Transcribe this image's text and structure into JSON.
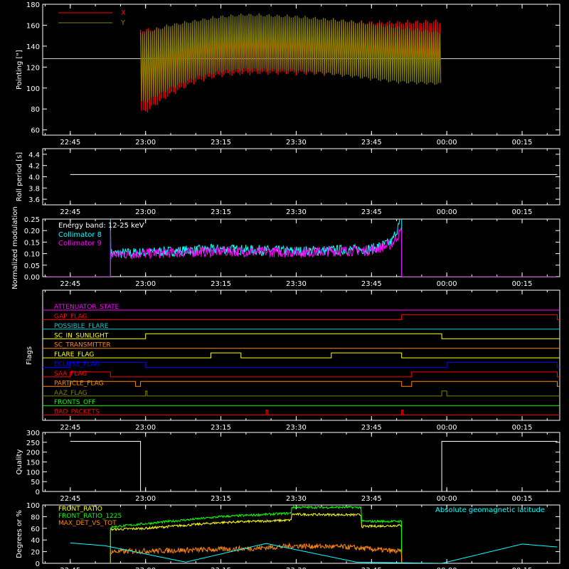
{
  "chart_data": {
    "type": "line",
    "time_ticks": [
      "22:45",
      "23:00",
      "23:15",
      "23:30",
      "23:45",
      "00:00",
      "00:15"
    ],
    "panels": [
      {
        "id": "pointing",
        "ylabel": "Pointing [\"]",
        "ylim": [
          55,
          180
        ],
        "yticks": [
          60,
          80,
          100,
          120,
          140,
          160,
          180
        ],
        "reference_line": 128,
        "legend": [
          {
            "name": "X",
            "color": "#ff0000"
          },
          {
            "name": "Y",
            "color": "#808000"
          }
        ],
        "series": [
          {
            "name": "X",
            "color": "#ff0000",
            "start": "22:59",
            "end": "23:59",
            "x_time": [
              "23:00",
              "23:05",
              "23:10",
              "23:15",
              "23:20",
              "23:30",
              "23:40",
              "23:50",
              "23:59"
            ],
            "upper": [
              158,
              160,
              162,
              163,
              164,
              164,
              165,
              165,
              166
            ],
            "lower": [
              75,
              92,
              104,
              110,
              112,
              112,
              111,
              111,
              110
            ]
          },
          {
            "name": "Y",
            "color": "#808000",
            "start": "22:59",
            "end": "23:59",
            "x_time": [
              "23:00",
              "23:05",
              "23:10",
              "23:15",
              "23:20",
              "23:30",
              "23:40",
              "23:50",
              "23:59"
            ],
            "upper": [
              155,
              162,
              166,
              170,
              172,
              170,
              166,
              160,
              155
            ],
            "lower": [
              85,
              98,
              108,
              114,
              116,
              115,
              110,
              104,
              102
            ]
          }
        ]
      },
      {
        "id": "roll",
        "ylabel": "Roll period [s]",
        "ylim": [
          3.5,
          4.5
        ],
        "yticks": [
          3.6,
          3.8,
          4.0,
          4.2,
          4.4
        ],
        "series": [
          {
            "name": "",
            "color": "#ffffff",
            "start": "22:45",
            "end": "00:22",
            "value": 4.04
          }
        ]
      },
      {
        "id": "modulation",
        "ylabel": "Normalized modulation",
        "ylim": [
          0,
          0.25
        ],
        "yticks": [
          0.0,
          0.05,
          0.1,
          0.15,
          0.2,
          0.25
        ],
        "annotation": "Energy band: 12-25 keV",
        "series": [
          {
            "name": "Collimator 8",
            "color": "#00ffff",
            "start": "22:53",
            "end": "23:51",
            "x_time": [
              "22:53",
              "23:00",
              "23:15",
              "23:30",
              "23:45",
              "23:49",
              "23:51"
            ],
            "values": [
              0.1,
              0.105,
              0.12,
              0.11,
              0.12,
              0.15,
              0.25
            ]
          },
          {
            "name": "Collimator 9",
            "color": "#ff00ff",
            "start": "22:53",
            "end": "23:51",
            "x_time": [
              "22:53",
              "23:00",
              "23:15",
              "23:30",
              "23:45",
              "23:49",
              "23:51"
            ],
            "values": [
              0.095,
              0.1,
              0.11,
              0.105,
              0.115,
              0.14,
              0.2
            ]
          }
        ]
      },
      {
        "id": "flags",
        "ylabel": "Flags",
        "flags": [
          {
            "name": "ATTENUATOR_STATE",
            "color": "#ff00ff",
            "high": []
          },
          {
            "name": "GAP_FLAG",
            "color": "#ff0000",
            "high": [
              [
                "23:51",
                "00:22"
              ]
            ]
          },
          {
            "name": "POSSIBLE_FLARE",
            "color": "#00cccc",
            "high": []
          },
          {
            "name": "SC_IN_SUNLIGHT",
            "color": "#ffff00",
            "high": [
              [
                "23:00",
                "23:59"
              ]
            ]
          },
          {
            "name": "SC_TRANSMITTER",
            "color": "#ff8800",
            "high": []
          },
          {
            "name": "FLARE_FLAG",
            "color": "#ffff00",
            "high": [
              [
                "23:13",
                "23:19"
              ],
              [
                "23:37",
                "23:51"
              ]
            ]
          },
          {
            "name": "ECLIPSE_FLAG",
            "color": "#0000ff",
            "high": [
              [
                "22:45",
                "23:00"
              ],
              [
                "00:00",
                "00:22"
              ]
            ]
          },
          {
            "name": "SAA_FLAG",
            "color": "#ff0000",
            "high": [
              [
                "22:45",
                "22:53"
              ],
              [
                "23:53",
                "00:22"
              ]
            ]
          },
          {
            "name": "PARTICLE_FLAG",
            "color": "#ff8800",
            "high": [
              [
                "22:45",
                "22:58"
              ],
              [
                "22:59",
                "23:51"
              ],
              [
                "23:53",
                "00:22"
              ]
            ]
          },
          {
            "name": "AAZ_FLAG",
            "color": "#808000",
            "high": [
              [
                "23:00",
                "23:00"
              ],
              [
                "23:59",
                "00:00"
              ]
            ]
          },
          {
            "name": "FRONTS_OFF",
            "color": "#00ff00",
            "high": []
          },
          {
            "name": "BAD_PACKETS",
            "color": "#ff0000",
            "high": [
              [
                "23:24",
                "23:24"
              ],
              [
                "23:51",
                "23:51"
              ]
            ]
          }
        ]
      },
      {
        "id": "quality",
        "ylabel": "Quality",
        "ylim": [
          0,
          300
        ],
        "yticks": [
          0,
          50,
          100,
          150,
          200,
          250,
          300
        ],
        "series": [
          {
            "name": "",
            "color": "#ffffff",
            "segments": [
              [
                [
                  "22:45",
                  255
                ],
                [
                  "22:59",
                  255
                ],
                [
                  "22:59",
                  0
                ],
                [
                  "23:59",
                  0
                ],
                [
                  "23:59",
                  255
                ],
                [
                  "00:22",
                  255
                ]
              ]
            ]
          }
        ]
      },
      {
        "id": "ratios",
        "ylabel": "Degrees or %",
        "ylim": [
          0,
          100
        ],
        "yticks": [
          0,
          20,
          40,
          60,
          80,
          100
        ],
        "right_label": "Absolute geomagnetic latitude",
        "series": [
          {
            "name": "FRONT_RATIO",
            "color": "#ffff00",
            "start": "22:53",
            "end": "23:51",
            "x_time": [
              "22:53",
              "23:00",
              "23:15",
              "23:29",
              "23:29",
              "23:43",
              "23:43",
              "23:51"
            ],
            "values": [
              58,
              60,
              70,
              74,
              84,
              83,
              63,
              65
            ]
          },
          {
            "name": "FRONT_RATIO_1225",
            "color": "#00ff00",
            "start": "22:53",
            "end": "23:51",
            "x_time": [
              "22:53",
              "23:00",
              "23:15",
              "23:29",
              "23:29",
              "23:43",
              "23:43",
              "23:51"
            ],
            "values": [
              62,
              68,
              80,
              86,
              96,
              96,
              72,
              72
            ]
          },
          {
            "name": "MAX_DET_VS_TOT",
            "color": "#ff8800",
            "start": "22:53",
            "end": "23:51",
            "x_time": [
              "22:53",
              "23:05",
              "23:20",
              "23:30",
              "23:40",
              "23:51"
            ],
            "values": [
              20,
              22,
              25,
              30,
              28,
              20
            ]
          },
          {
            "name": "geomag",
            "color": "#00ffff",
            "start": "22:45",
            "end": "00:22",
            "x_time": [
              "22:45",
              "22:52",
              "23:08",
              "23:24",
              "23:42",
              "23:59",
              "00:15",
              "00:22"
            ],
            "values": [
              35,
              30,
              2,
              34,
              2,
              0,
              33,
              28
            ]
          }
        ]
      }
    ]
  }
}
